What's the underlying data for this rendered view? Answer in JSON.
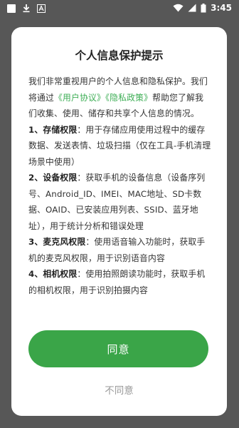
{
  "status_bar": {
    "time": "3:45",
    "icons": [
      "app-square-icon",
      "download-icon",
      "a-box-icon",
      "wifi-icon",
      "signal-icon",
      "battery-icon"
    ]
  },
  "dialog": {
    "title": "个人信息保护提示",
    "intro_pre": "我们非常重视用户的个人信息和隐私保护。我们将通过",
    "link_agreement": "《用户协议》",
    "link_privacy": "《隐私政策》",
    "intro_post": "帮助您了解我们收集、使用、储存和共享个人信息的情况。",
    "sections": [
      {
        "num": "1、",
        "name": "存储权限",
        "desc": "：用于存储应用使用过程中的缓存数据、发送表情、垃圾扫描（仅在工具-手机清理场景中使用）"
      },
      {
        "num": "2、",
        "name": "设备权限",
        "desc": "：获取手机的设备信息（设备序列号、Android_ID、IMEI、MAC地址、SD卡数据、OAID、已安装应用列表、SSID、蓝牙地址），用于统计分析和错误处理"
      },
      {
        "num": "3、",
        "name": "麦克风权限",
        "desc": "：使用语音输入功能时，获取手机的麦克风权限，用于识别语音内容"
      },
      {
        "num": "4、",
        "name": "相机权限",
        "desc": "：使用拍照朗读功能时，获取手机的相机权限，用于识别拍摄内容"
      }
    ],
    "agree_label": "同意",
    "disagree_label": "不同意"
  },
  "colors": {
    "accent": "#3aa548",
    "link": "#3dae55",
    "overlay": "#575757"
  }
}
